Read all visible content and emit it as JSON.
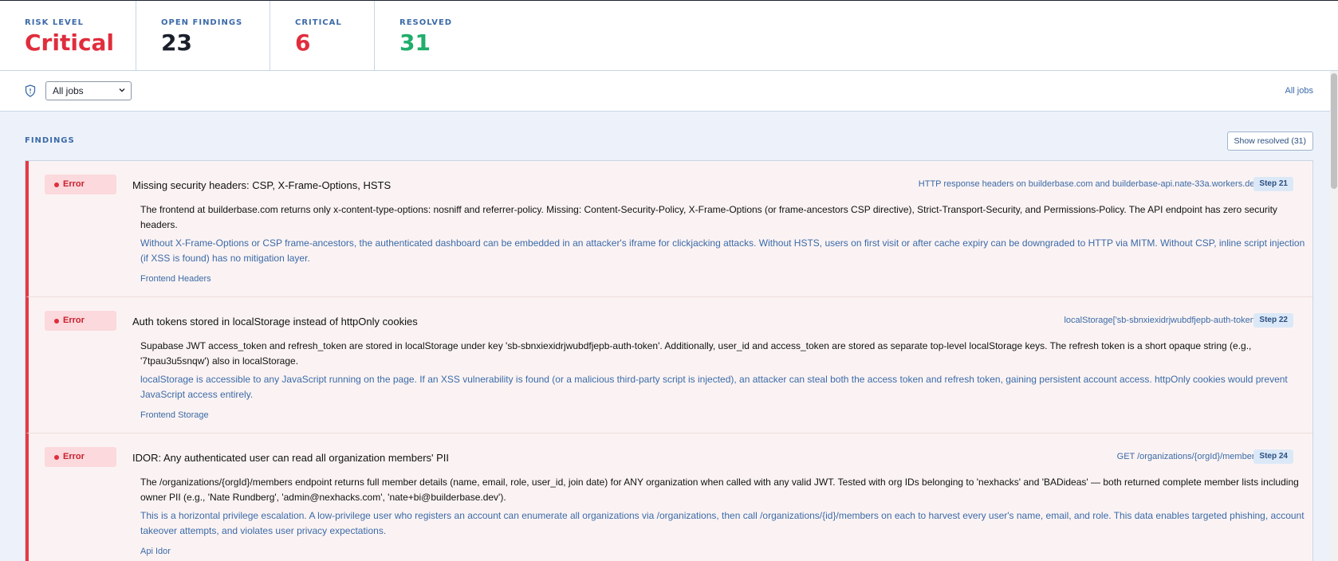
{
  "stats": {
    "risk": {
      "label": "RISK LEVEL",
      "value": "Critical",
      "color": "#e02d3c"
    },
    "open": {
      "label": "OPEN FINDINGS",
      "value": "23",
      "color": "#1a1f2b"
    },
    "critical": {
      "label": "CRITICAL",
      "value": "6",
      "color": "#e02d3c"
    },
    "resolved": {
      "label": "RESOLVED",
      "value": "31",
      "color": "#1fae6b"
    }
  },
  "toolbar": {
    "shield_icon": "shield-icon",
    "job_select_value": "All jobs",
    "right_link": "All jobs"
  },
  "findings": {
    "heading": "FINDINGS",
    "show_resolved": "Show resolved (31)",
    "items": [
      {
        "severity": "Error",
        "title": "Missing security headers: CSP, X-Frame-Options, HSTS",
        "location": "HTTP response headers on builderbase.com and builderbase-api.nate-33a.workers.dev",
        "step": "Step 21",
        "description": "The frontend at builderbase.com returns only x-content-type-options: nosniff and referrer-policy. Missing: Content-Security-Policy, X-Frame-Options (or frame-ancestors CSP directive), Strict-Transport-Security, and Permissions-Policy. The API endpoint has zero security headers.",
        "impact": "Without X-Frame-Options or CSP frame-ancestors, the authenticated dashboard can be embedded in an attacker's iframe for clickjacking attacks. Without HSTS, users on first visit or after cache expiry can be downgraded to HTTP via MITM. Without CSP, inline script injection (if XSS is found) has no mitigation layer.",
        "category": "Frontend Headers"
      },
      {
        "severity": "Error",
        "title": "Auth tokens stored in localStorage instead of httpOnly cookies",
        "location": "localStorage['sb-sbnxiexidrjwubdfjepb-auth-token']",
        "step": "Step 22",
        "description": "Supabase JWT access_token and refresh_token are stored in localStorage under key 'sb-sbnxiexidrjwubdfjepb-auth-token'. Additionally, user_id and access_token are stored as separate top-level localStorage keys. The refresh token is a short opaque string (e.g., '7tpau3u5snqw') also in localStorage.",
        "impact": "localStorage is accessible to any JavaScript running on the page. If an XSS vulnerability is found (or a malicious third-party script is injected), an attacker can steal both the access token and refresh token, gaining persistent account access. httpOnly cookies would prevent JavaScript access entirely.",
        "category": "Frontend Storage"
      },
      {
        "severity": "Error",
        "title": "IDOR: Any authenticated user can read all organization members' PII",
        "location": "GET /organizations/{orgId}/members",
        "step": "Step 24",
        "description": "The /organizations/{orgId}/members endpoint returns full member details (name, email, role, user_id, join date) for ANY organization when called with any valid JWT. Tested with org IDs belonging to 'nexhacks' and 'BADideas' — both returned complete member lists including owner PII (e.g., 'Nate Rundberg', 'admin@nexhacks.com', 'nate+bi@builderbase.dev').",
        "impact": "This is a horizontal privilege escalation. A low-privilege user who registers an account can enumerate all organizations via /organizations, then call /organizations/{id}/members on each to harvest every user's name, email, and role. This data enables targeted phishing, account takeover attempts, and violates user privacy expectations.",
        "category": "Api Idor"
      }
    ]
  }
}
